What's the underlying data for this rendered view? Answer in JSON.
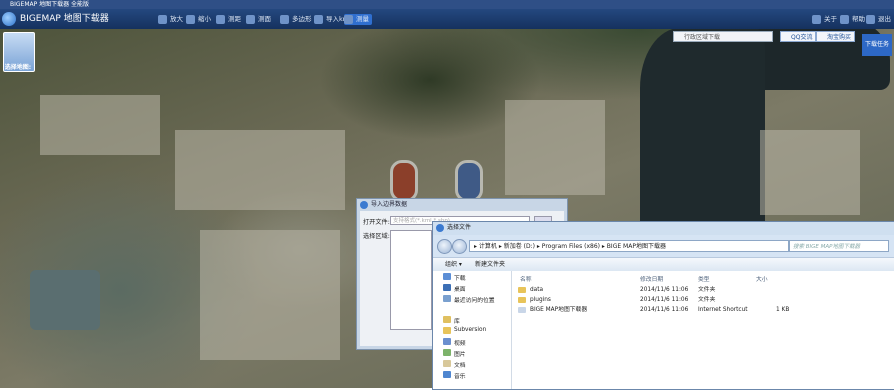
{
  "app": {
    "window_title": "BIGEMAP 地图下载器 全能版",
    "logo_text": "BIGEMAP 地图下载器"
  },
  "toolbar": {
    "items": [
      "放大",
      "缩小",
      "测距",
      "测面",
      "多边形",
      "导入kml",
      "测量"
    ],
    "active_index": 6,
    "right_items": [
      "关于",
      "帮助",
      "退出"
    ]
  },
  "sidebar": {
    "map_select_label": "选择地图:"
  },
  "top_right": {
    "region_placeholder": "行政区域下载",
    "qq_label": "QQ交流",
    "taobao_label": "淘宝购买",
    "download_task_label": "下载任务"
  },
  "import_dialog": {
    "title": "导入边界数据",
    "open_file_label": "打开文件:",
    "open_file_placeholder": "支持格式(*.kml *.shp)",
    "region_label": "选择区域:"
  },
  "file_dialog": {
    "title": "选择文件",
    "path_segments": [
      "计算机",
      "新加卷 (D:)",
      "Program Files (x86)",
      "BIGE MAP地图下载器"
    ],
    "search_placeholder": "搜索 BIGE MAP地图下载器",
    "organize_label": "组织 ▾",
    "new_folder_label": "新建文件夹",
    "nav_items": [
      {
        "label": "下载",
        "icon": "download-folder-icon"
      },
      {
        "label": "桌面",
        "icon": "desktop-icon"
      },
      {
        "label": "最近访问的位置",
        "icon": "recent-places-icon"
      },
      {
        "label": "库",
        "icon": "library-icon"
      },
      {
        "label": "Subversion",
        "icon": "folder-icon"
      },
      {
        "label": "视频",
        "icon": "video-icon"
      },
      {
        "label": "图片",
        "icon": "pictures-icon"
      },
      {
        "label": "文档",
        "icon": "documents-icon"
      },
      {
        "label": "音乐",
        "icon": "music-icon"
      }
    ],
    "columns": {
      "name": "名称",
      "date": "修改日期",
      "type": "类型",
      "size": "大小"
    },
    "files": [
      {
        "name": "data",
        "date": "2014/11/6 11:06",
        "type": "文件夹",
        "size": ""
      },
      {
        "name": "plugins",
        "date": "2014/11/6 11:06",
        "type": "文件夹",
        "size": ""
      },
      {
        "name": "BIGE MAP地图下载器",
        "date": "2014/11/6 11:06",
        "type": "Internet Shortcut",
        "size": "1 KB"
      }
    ]
  }
}
